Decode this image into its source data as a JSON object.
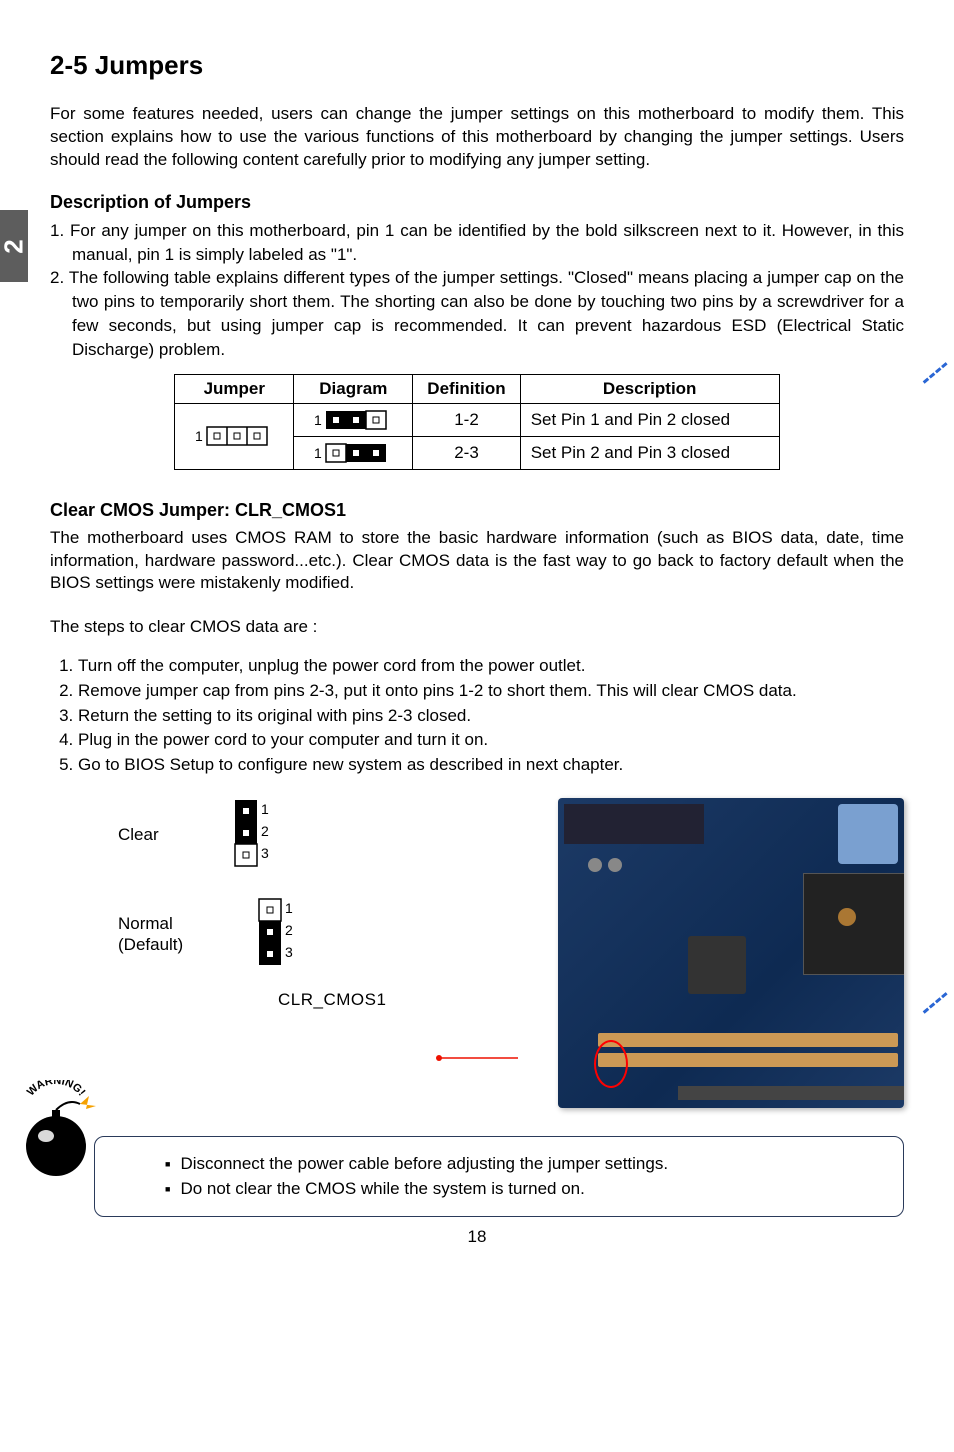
{
  "chapter_tab": "2",
  "title": "2-5 Jumpers",
  "intro": "For some features needed, users can change the jumper settings on this motherboard to modify them. This section explains how to use the various functions of this motherboard by changing the jumper settings. Users should read the following content carefully prior to modifying any jumper setting.",
  "desc_heading": "Description of Jumpers",
  "desc_item1": "1. For any jumper on this motherboard, pin 1 can be identified by the bold silkscreen next to it. However, in this manual, pin 1 is simply labeled as \"1\".",
  "desc_item2": "2. The following table explains different types of the jumper settings. \"Closed\" means placing a jumper cap on the two pins to temporarily short them. The shorting can also be done by touching two pins by a screwdriver for a few seconds, but using jumper cap is recommended. It can prevent hazardous ESD (Electrical Static Discharge) problem.",
  "table": {
    "headers": [
      "Jumper",
      "Diagram",
      "Definition",
      "Description"
    ],
    "rows": [
      {
        "definition": "1-2",
        "description": "Set Pin 1 and Pin 2 closed",
        "diagram_label_1": "1"
      },
      {
        "definition": "2-3",
        "description": "Set Pin 2 and Pin 3 closed",
        "diagram_label_1": "1"
      }
    ],
    "jumper_label_1": "1"
  },
  "cmos_heading": "Clear CMOS Jumper: CLR_CMOS1",
  "cmos_desc": "The motherboard uses CMOS RAM to store the basic hardware information (such as BIOS data, date, time information, hardware password...etc.). Clear CMOS data is the fast way to go back to factory default when the BIOS settings were mistakenly modified.",
  "steps_lead": "The steps to clear CMOS data are :",
  "steps": [
    "Turn off the computer, unplug the power cord from the power outlet.",
    "Remove jumper cap from pins 2-3, put it onto pins 1-2 to short them. This will clear CMOS data.",
    "Return the setting to its original with pins 2-3 closed.",
    "Plug in the power cord to your computer and turn it on.",
    "Go to BIOS Setup to configure new system as described in next chapter."
  ],
  "dg_clear_label": "Clear",
  "dg_normal_label_line1": "Normal",
  "dg_normal_label_line2": "(Default)",
  "dg_clear_pins": [
    "1",
    "2",
    "3"
  ],
  "dg_normal_pins": [
    "1",
    "2",
    "3"
  ],
  "dg_name": "CLR_CMOS1",
  "warning_badge": "WARNING!",
  "warnings": [
    "Disconnect the power cable before adjusting the jumper settings.",
    "Do not clear the CMOS while the system is turned on."
  ],
  "page_number": "18"
}
